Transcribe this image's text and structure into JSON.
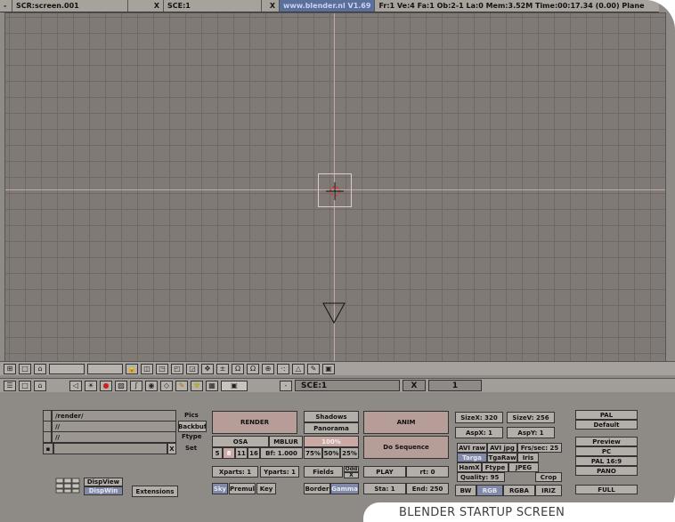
{
  "topbar": {
    "items": [
      "SCR:screen.001",
      "X",
      "SCE:1",
      "X",
      "www.blender.nl  V1.69",
      "Fr:1  Ve:4 Fa:1  Ob:2-1 La:0  Mem:3.52M  Time:00:17.34 (0.00)  Plane"
    ]
  },
  "header_scene": {
    "scene": "SCE:1",
    "x": "X",
    "frame": "1"
  },
  "paths": {
    "pics": "/render/",
    "backbuf": "//",
    "ftype": "//"
  },
  "labels": {
    "pics": "Pics",
    "backbuf": "Backbuf",
    "ftype": "Ftype",
    "set": "Set",
    "x": "X"
  },
  "buttons": {
    "render": "RENDER",
    "shadows": "Shadows",
    "panorama": "Panorama",
    "anim": "ANIM",
    "osa": "OSA",
    "mblur": "MBLUR",
    "pct100": "100%",
    "do_sequence": "Do Sequence",
    "osa_values": [
      "5",
      "8",
      "11",
      "16"
    ],
    "bf": "Bf: 1.000",
    "pct75": "75%",
    "pct50": "50%",
    "pct25": "25%",
    "xparts": "Xparts: 1",
    "yparts": "Yparts: 1",
    "fields": "Fields",
    "odd": "Odd",
    "odd_x": "X",
    "play": "PLAY",
    "rt": "rt: 0",
    "sky": "Sky",
    "premul": "Premul",
    "key": "Key",
    "border": "Border",
    "gamma": "Gamma",
    "sta": "Sta: 1",
    "end": "End: 250",
    "dispview": "DispView",
    "dispwin": "DispWin",
    "extensions": "Extensions"
  },
  "format": {
    "sizex": "SizeX: 320",
    "sizey": "SizeV: 256",
    "aspx": "AspX: 1",
    "aspy": "AspY: 1",
    "avi_raw": "AVI raw",
    "avi_jpg": "AVI jpg",
    "frs": "Frs/sec: 25",
    "targa": "Targa",
    "tgaraw": "TgaRaw",
    "iris": "Iris",
    "hamx": "HamX",
    "ftype": "Ftype",
    "jpeg": "JPEG",
    "quality": "Quality: 95",
    "crop": "Crop",
    "bw": "BW",
    "rgb": "RGB",
    "rgba": "RGBA",
    "iriz": "IRIZ"
  },
  "presets": {
    "pal": "PAL",
    "default": "Default",
    "preview": "Preview",
    "pc": "PC",
    "pal169": "PAL 16:9",
    "pano": "PANO",
    "full": "FULL"
  },
  "caption": "BLENDER STARTUP SCREEN"
}
